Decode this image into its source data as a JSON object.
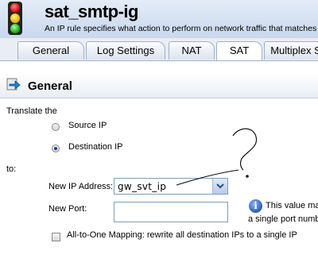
{
  "header": {
    "title": "sat_smtp-ig",
    "description": "An IP rule specifies what action to perform on network traffic that matches"
  },
  "tabs": [
    {
      "label": "General",
      "active": false
    },
    {
      "label": "Log Settings",
      "active": false
    },
    {
      "label": "NAT",
      "active": false
    },
    {
      "label": "SAT",
      "active": true
    },
    {
      "label": "Multiplex S",
      "active": false
    }
  ],
  "section": {
    "title": "General",
    "icon": "arrow-right-icon"
  },
  "form": {
    "translate_label": "Translate the",
    "source_ip_label": "Source IP",
    "destination_ip_label": "Destination IP",
    "selected": "Destination IP",
    "to_label": "to:",
    "new_ip_label": "New IP Address:",
    "new_ip_value": "gw_svt_ip",
    "new_port_label": "New Port:",
    "new_port_value": "",
    "info_line1": "This value mat",
    "info_line2": "a single port numb",
    "all_to_one_label": "All-to-One Mapping: rewrite all destination IPs to a single IP",
    "all_to_one_checked": false
  },
  "colors": {
    "header_bg": "#c9d8ee",
    "tab_border": "#9fb0c6",
    "radio_dot": "#1a3e8c",
    "info_icon": "#2456b5"
  }
}
